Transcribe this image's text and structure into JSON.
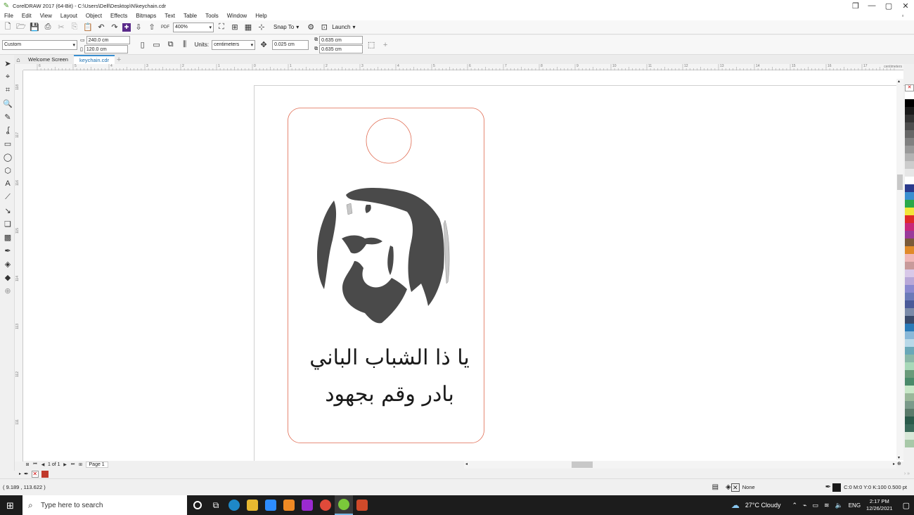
{
  "window": {
    "title": "CorelDRAW 2017 (64-Bit) - C:\\Users\\Dell\\Desktop\\N\\keychain.cdr"
  },
  "menu": [
    "File",
    "Edit",
    "View",
    "Layout",
    "Object",
    "Effects",
    "Bitmaps",
    "Text",
    "Table",
    "Tools",
    "Window",
    "Help"
  ],
  "toolbar": {
    "zoom": "400%",
    "snap_to": "Snap To",
    "launch": "Launch"
  },
  "propbar": {
    "preset": "Custom",
    "width": "240.0 cm",
    "height": "120.0 cm",
    "units_label": "Units:",
    "units": "centimeters",
    "nudge": "0.025 cm",
    "dup_x": "0.635 cm",
    "dup_y": "0.635 cm"
  },
  "tabs": [
    {
      "label": "Welcome Screen"
    },
    {
      "label": "keychain.cdr"
    }
  ],
  "rulers": {
    "h_ticks": [
      "6",
      "5",
      "4",
      "3",
      "2",
      "1",
      "0",
      "1",
      "2",
      "3",
      "4",
      "5",
      "6",
      "7",
      "8",
      "9",
      "10",
      "11",
      "12",
      "13",
      "14",
      "15",
      "16",
      "17"
    ],
    "unit": "centimeters",
    "v_ticks": [
      "118",
      "117",
      "116",
      "115",
      "114",
      "113",
      "112",
      "111"
    ]
  },
  "artwork": {
    "text_line1": "يا ذا الشباب الباني",
    "text_line2": "بادر وقم بجهود",
    "outline_color": "#e06a50"
  },
  "pagenav": {
    "page_of": "1 of 1",
    "page_tab": "Page 1"
  },
  "palette": [
    "#ffffff",
    "#000000",
    "#1a1a1a",
    "#333333",
    "#4d4d4d",
    "#666666",
    "#808080",
    "#999999",
    "#b3b3b3",
    "#cccccc",
    "#e6e6e6",
    "#ffffff",
    "#2a3a8c",
    "#3a8fd0",
    "#2aa84a",
    "#f2e63a",
    "#e02a2a",
    "#c8287a",
    "#9a3a9a",
    "#7a5a3a",
    "#e08a2a",
    "#f0b8b8",
    "#c89a9a",
    "#d8c8e8",
    "#b8a8d8",
    "#8a8ad0",
    "#6a7ab8",
    "#4a5a98",
    "#7a8aa8",
    "#3a4a6a",
    "#2a7ab8",
    "#8ab8d8",
    "#b8d8e8",
    "#6aa8b8",
    "#8ab8a8",
    "#a8d8b8",
    "#6a9a7a",
    "#4a8a6a",
    "#c8e8c8",
    "#9ab89a",
    "#7a9a8a",
    "#5a7a6a",
    "#2a5a4a",
    "#3a6a5a",
    "#d8e8d8",
    "#a8c8a8"
  ],
  "statusbar": {
    "coords": "( 9.189 , 113.622 )",
    "fill": "None",
    "outline": "C:0 M:0 Y:0 K:100  0.500 pt"
  },
  "taskbar": {
    "search_placeholder": "Type here to search",
    "weather": "27°C  Cloudy",
    "lang": "ENG",
    "time": "2:17 PM",
    "date": "12/26/2021"
  }
}
